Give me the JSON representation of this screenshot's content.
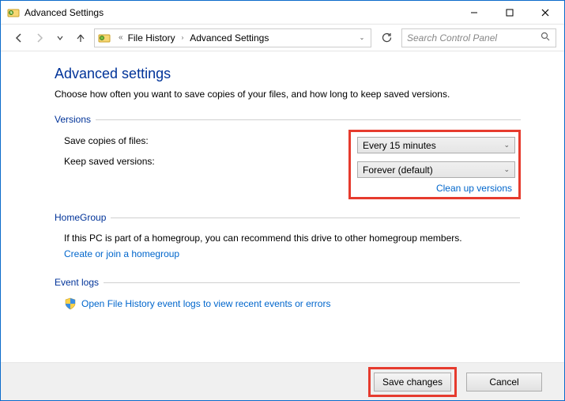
{
  "title": "Advanced Settings",
  "breadcrumbs": {
    "item1": "File History",
    "item2": "Advanced Settings"
  },
  "search": {
    "placeholder": "Search Control Panel"
  },
  "page": {
    "heading": "Advanced settings",
    "subtext": "Choose how often you want to save copies of your files, and how long to keep saved versions."
  },
  "versions": {
    "legend": "Versions",
    "label_save": "Save copies of files:",
    "value_save": "Every 15 minutes",
    "label_keep": "Keep saved versions:",
    "value_keep": "Forever (default)",
    "cleanup_link": "Clean up versions"
  },
  "homegroup": {
    "legend": "HomeGroup",
    "text": "If this PC is part of a homegroup, you can recommend this drive to other homegroup members.",
    "link": "Create or join a homegroup"
  },
  "eventlogs": {
    "legend": "Event logs",
    "link": "Open File History event logs to view recent events or errors"
  },
  "footer": {
    "save": "Save changes",
    "cancel": "Cancel"
  }
}
